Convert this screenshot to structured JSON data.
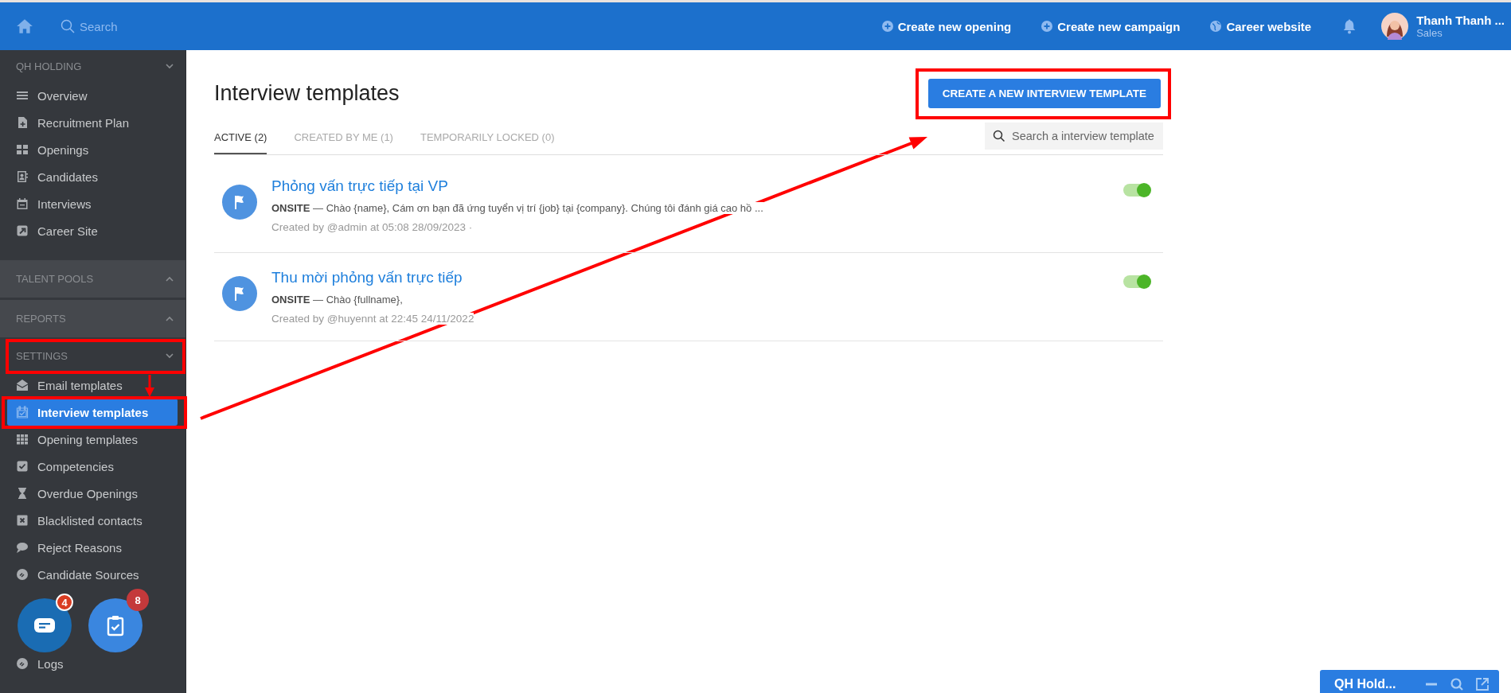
{
  "topbar": {
    "search": {
      "placeholder": "Search"
    },
    "actions": [
      {
        "label": "Create new opening"
      },
      {
        "label": "Create new campaign"
      },
      {
        "label": "Career website"
      }
    ],
    "user": {
      "name": "Thanh Thanh ...",
      "role": "Sales"
    }
  },
  "sidebar": {
    "sections": [
      {
        "title": "QH HOLDING",
        "expanded": true,
        "items": [
          {
            "label": "Overview",
            "selected": false
          },
          {
            "label": "Recruitment Plan",
            "selected": false
          },
          {
            "label": "Openings",
            "selected": false
          },
          {
            "label": "Candidates",
            "selected": false
          },
          {
            "label": "Interviews",
            "selected": false
          },
          {
            "label": "Career Site",
            "selected": false
          }
        ]
      },
      {
        "title": "TALENT POOLS",
        "expanded": false
      },
      {
        "title": "REPORTS",
        "expanded": false
      },
      {
        "title": "SETTINGS",
        "expanded": true,
        "items": [
          {
            "label": "Email templates",
            "selected": false
          },
          {
            "label": "Interview templates",
            "selected": true
          },
          {
            "label": "Opening templates",
            "selected": false
          },
          {
            "label": "Competencies",
            "selected": false
          },
          {
            "label": "Overdue Openings",
            "selected": false
          },
          {
            "label": "Blacklisted contacts",
            "selected": false
          },
          {
            "label": "Reject Reasons",
            "selected": false
          },
          {
            "label": "Candidate Sources",
            "selected": false
          },
          {
            "label": "Logs",
            "selected": false
          }
        ]
      }
    ]
  },
  "main": {
    "title": "Interview templates",
    "create_button": "CREATE A NEW INTERVIEW TEMPLATE",
    "tabs": [
      {
        "label": "ACTIVE (2)",
        "selected": true
      },
      {
        "label": "CREATED BY ME (1)",
        "selected": false
      },
      {
        "label": "TEMPORARILY LOCKED (0)",
        "selected": false
      }
    ],
    "search": {
      "placeholder": "Search a interview template"
    },
    "templates": [
      {
        "title": "Phỏng vấn trực tiếp tại VP",
        "summary": "**ONSITE** — Chào {name}, Cám ơn bạn đã ứng tuyển vị trí {job} tại {company}. Chúng tôi đánh giá cao hồ ...",
        "meta": "Created by @admin at 05:08 28/09/2023 ·",
        "on": true
      },
      {
        "title": "Thu mời phỏng vấn trực tiếp",
        "summary": "**ONSITE** — Chào {fullname},",
        "meta": "Created by @huyennt at 22:45 24/11/2022",
        "on": true
      }
    ]
  },
  "floating": [
    {
      "badge": "4"
    },
    {
      "badge": "8"
    }
  ],
  "widget": {
    "title": "QH Hold..."
  }
}
